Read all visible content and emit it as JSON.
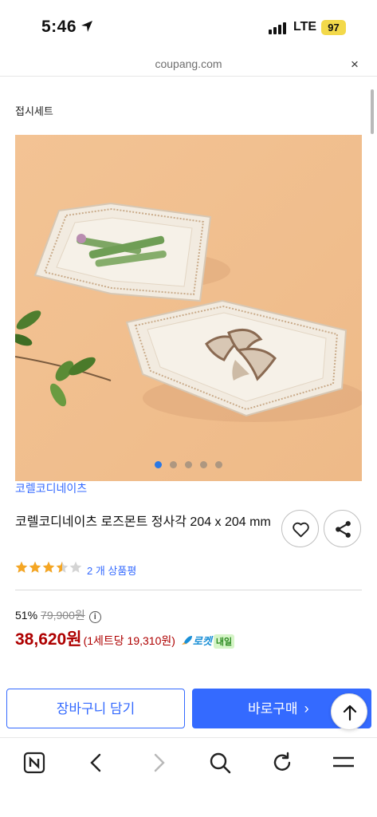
{
  "status_bar": {
    "time": "5:46",
    "network": "LTE",
    "battery": "97"
  },
  "browser": {
    "url": "coupang.com",
    "close": "×"
  },
  "breadcrumb": "접시세트",
  "carousel": {
    "total": 5,
    "active": 1
  },
  "product": {
    "brand": "코렐코디네이츠",
    "title": "코렐코디네이츠 로즈몬트 정사각 204 x 204 mm",
    "rating": 3.5,
    "review_count": "2 개 상품평",
    "discount": "51%",
    "original_price": "79,900원",
    "info_icon": "i",
    "sale_price": "38,620원",
    "unit_price": "(1세트당 19,310원)",
    "rocket_label": "로켓",
    "next_day_label": "내일"
  },
  "actions": {
    "cart_label": "장바구니 담기",
    "buy_label": "바로구매",
    "buy_chevron": "›"
  },
  "colors": {
    "accent": "#346aff",
    "price": "#ae0000",
    "background_photo": "#f0c08f"
  }
}
